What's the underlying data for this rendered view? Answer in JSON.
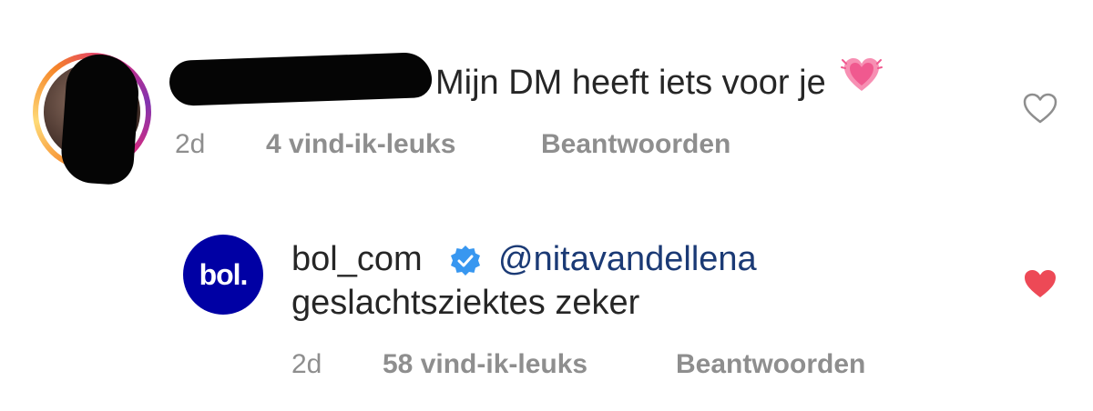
{
  "comment_1": {
    "text": "Mijn DM heeft iets voor je",
    "emoji": "growing-heart-emoji",
    "time": "2d",
    "likes": "4 vind-ik-leuks",
    "reply_label": "Beantwoorden",
    "liked": false,
    "username_redacted": true
  },
  "comment_2": {
    "username": "bol_com",
    "avatar_text": "bol.",
    "verified": true,
    "mention": "@nitavandellena",
    "text": "geslachtsziektes zeker",
    "time": "2d",
    "likes": "58 vind-ik-leuks",
    "reply_label": "Beantwoorden",
    "liked": true
  },
  "colors": {
    "text": "#262626",
    "meta": "#8e8e8e",
    "mention": "#1b3a75",
    "like_active": "#ed4956",
    "bol_blue": "#0000a4",
    "verified": "#3897f0"
  }
}
